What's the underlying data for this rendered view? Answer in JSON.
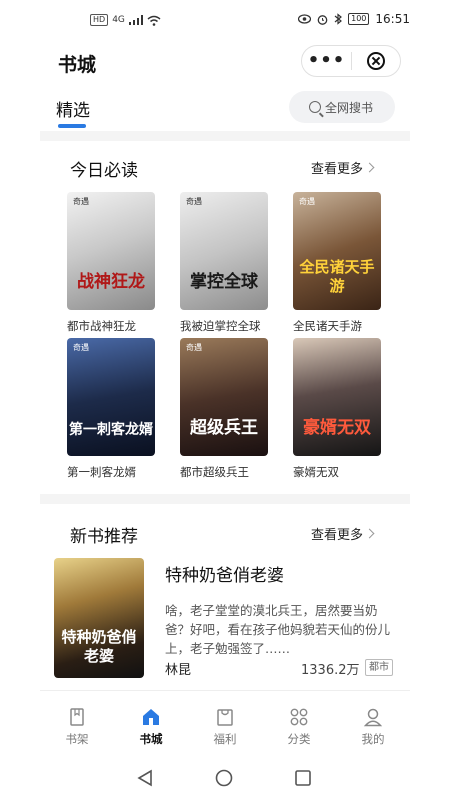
{
  "status_bar": {
    "left_chips": [
      "HD",
      "4G"
    ],
    "battery": "100",
    "time": "16:51"
  },
  "header": {
    "title": "书城",
    "more_label": "•••"
  },
  "tabs": {
    "active": "精选",
    "search_placeholder": "全网搜书"
  },
  "today": {
    "title": "今日必读",
    "more": "查看更多",
    "books": [
      {
        "name": "都市战神狂龙",
        "cover_text": "战神狂龙",
        "cover_color": "#d9d9d9",
        "text_color": "#b01818"
      },
      {
        "name": "我被迫掌控全球",
        "cover_text": "掌控全球",
        "cover_color": "#cfcfcf",
        "text_color": "#222222"
      },
      {
        "name": "全民诸天手游",
        "cover_text": "全民诸天手游",
        "cover_color": "#6b4630",
        "text_color": "#ffd23a"
      },
      {
        "name": "第一刺客龙婿",
        "cover_text": "第一刺客龙婿",
        "cover_color": "#1d2b4a",
        "text_color": "#ffffff"
      },
      {
        "name": "都市超级兵王",
        "cover_text": "超级兵王",
        "cover_color": "#3b2a2a",
        "text_color": "#ffffff"
      },
      {
        "name": "豪婿无双",
        "cover_text": "豪婿无双",
        "cover_color": "#2b2b2b",
        "text_color": "#ff5a3c"
      }
    ]
  },
  "new_books": {
    "title": "新书推荐",
    "more": "查看更多",
    "item": {
      "title": "特种奶爸俏老婆",
      "desc": "啥，老子堂堂的漠北兵王，居然要当奶爸？好吧，看在孩子他妈貌若天仙的份儿上，老子勉强签了……",
      "author": "林昆",
      "count": "1336.2万",
      "tag": "都市",
      "cover_text": "特种奶爸俏老婆"
    }
  },
  "tabbar": {
    "items": [
      {
        "label": "书架",
        "icon": "bookshelf-icon"
      },
      {
        "label": "书城",
        "icon": "home-icon"
      },
      {
        "label": "福利",
        "icon": "gift-bag-icon"
      },
      {
        "label": "分类",
        "icon": "category-icon"
      },
      {
        "label": "我的",
        "icon": "profile-icon"
      }
    ]
  },
  "colors": {
    "accent": "#2a7ae2",
    "divider": "#f4f4f4"
  }
}
